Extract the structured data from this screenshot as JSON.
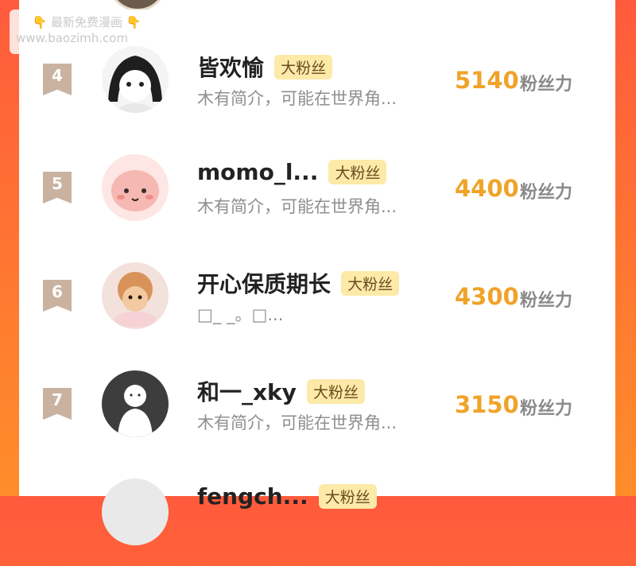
{
  "watermark": {
    "line1": "最新免费漫画",
    "line2": "www.baozimh.com",
    "hand_left": "👇",
    "hand_right": "👇"
  },
  "rows": [
    {
      "rank": "4",
      "name": "皆欢愉",
      "badge": "大粉丝",
      "bio": "木有简介，可能在世界角...",
      "count": "5140",
      "unit": "粉丝力"
    },
    {
      "rank": "5",
      "name": "momo_l...",
      "badge": "大粉丝",
      "bio": "木有简介，可能在世界角...",
      "count": "4400",
      "unit": "粉丝力"
    },
    {
      "rank": "6",
      "name": "开心保质期长",
      "badge": "大粉丝",
      "bio": "□_ _。□...",
      "count": "4300",
      "unit": "粉丝力"
    },
    {
      "rank": "7",
      "name": "和一_xky",
      "badge": "大粉丝",
      "bio": "木有简介，可能在世界角...",
      "count": "3150",
      "unit": "粉丝力"
    },
    {
      "rank": "",
      "name": "fengch...",
      "badge": "大粉丝",
      "bio": "",
      "count": "",
      "unit": ""
    }
  ],
  "colors": {
    "accent_orange": "#f0a329",
    "badge_bg": "#fde9a8",
    "rank_bg": "#c9b2a0",
    "frame": "#ff6a34"
  }
}
